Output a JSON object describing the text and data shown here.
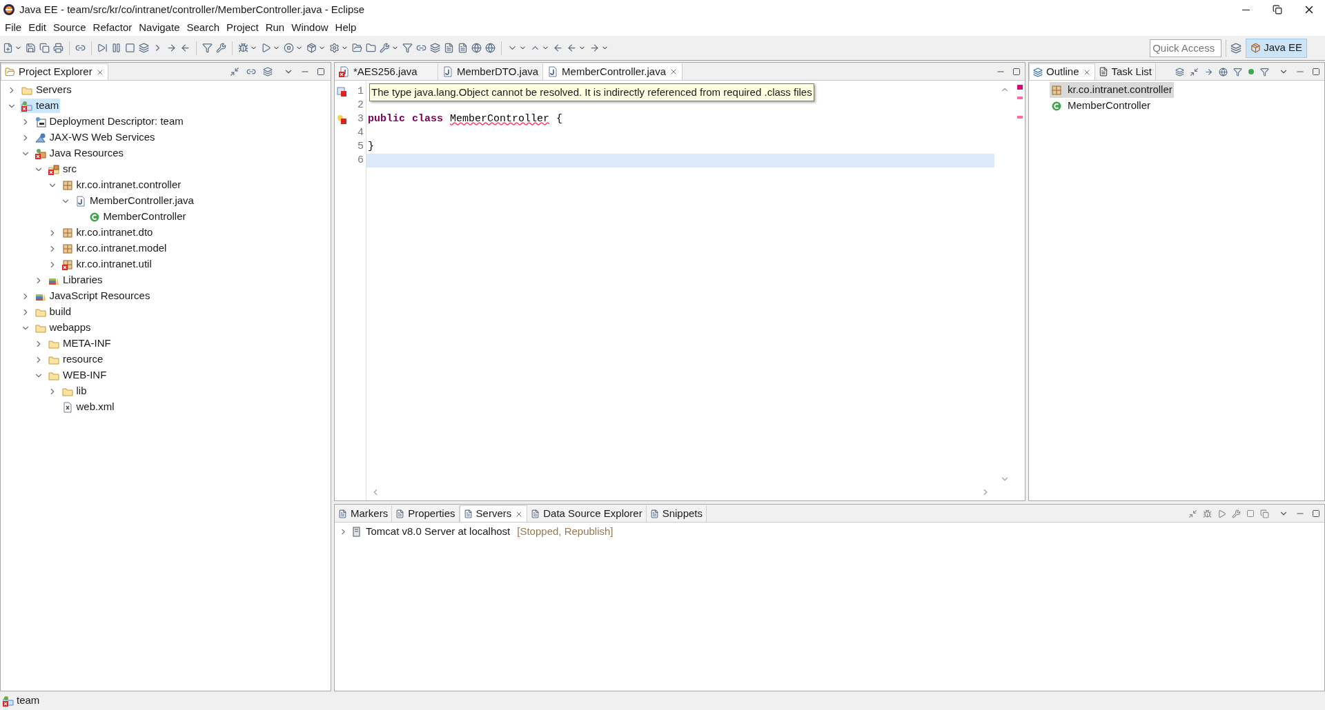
{
  "window": {
    "title": "Java EE - team/src/kr/co/intranet/controller/MemberController.java - Eclipse"
  },
  "menu": [
    "File",
    "Edit",
    "Source",
    "Refactor",
    "Navigate",
    "Search",
    "Project",
    "Run",
    "Window",
    "Help"
  ],
  "quick_access": {
    "placeholder": "Quick Access"
  },
  "perspectives": [
    {
      "label": "Java EE",
      "selected": true
    }
  ],
  "project_explorer": {
    "tabs": [
      {
        "label": "Project Explorer",
        "selected": true
      }
    ],
    "tree": [
      {
        "label": "Servers",
        "kind": "folder",
        "expanded": false,
        "selected": false,
        "error": false
      },
      {
        "label": "team",
        "kind": "project",
        "expanded": true,
        "selected": true,
        "error": true,
        "children": [
          {
            "label": "Deployment Descriptor: team",
            "kind": "descriptor",
            "expanded": false,
            "selected": false,
            "error": false
          },
          {
            "label": "JAX-WS Web Services",
            "kind": "webservice",
            "expanded": false,
            "selected": false,
            "error": false
          },
          {
            "label": "Java Resources",
            "kind": "resources",
            "expanded": true,
            "selected": false,
            "error": true,
            "children": [
              {
                "label": "src",
                "kind": "source",
                "expanded": true,
                "selected": false,
                "error": true,
                "children": [
                  {
                    "label": "kr.co.intranet.controller",
                    "kind": "package",
                    "expanded": true,
                    "selected": false,
                    "error": false,
                    "children": [
                      {
                        "label": "MemberController.java",
                        "kind": "java-file",
                        "expanded": true,
                        "selected": false,
                        "error": false,
                        "children": [
                          {
                            "label": "MemberController",
                            "kind": "class",
                            "selected": false,
                            "error": false
                          }
                        ]
                      }
                    ]
                  },
                  {
                    "label": "kr.co.intranet.dto",
                    "kind": "package",
                    "expanded": false,
                    "selected": false,
                    "error": false
                  },
                  {
                    "label": "kr.co.intranet.model",
                    "kind": "package",
                    "expanded": false,
                    "selected": false,
                    "error": false
                  },
                  {
                    "label": "kr.co.intranet.util",
                    "kind": "package",
                    "expanded": false,
                    "selected": false,
                    "error": true
                  }
                ]
              },
              {
                "label": "Libraries",
                "kind": "library",
                "expanded": false,
                "selected": false,
                "error": false
              }
            ]
          },
          {
            "label": "JavaScript Resources",
            "kind": "library",
            "expanded": false,
            "selected": false,
            "error": false
          },
          {
            "label": "build",
            "kind": "folder",
            "expanded": false,
            "selected": false,
            "error": false
          },
          {
            "label": "webapps",
            "kind": "folder",
            "expanded": true,
            "selected": false,
            "error": false,
            "children": [
              {
                "label": "META-INF",
                "kind": "folder",
                "expanded": false,
                "selected": false,
                "error": false
              },
              {
                "label": "resource",
                "kind": "folder",
                "expanded": false,
                "selected": false,
                "error": false
              },
              {
                "label": "WEB-INF",
                "kind": "folder",
                "expanded": true,
                "selected": false,
                "error": false,
                "children": [
                  {
                    "label": "lib",
                    "kind": "folder",
                    "expanded": false,
                    "selected": false,
                    "error": false
                  },
                  {
                    "label": "web.xml",
                    "kind": "xml",
                    "selected": false,
                    "error": false
                  }
                ]
              }
            ]
          }
        ]
      }
    ]
  },
  "editor": {
    "tabs": [
      {
        "label": "*AES256.java",
        "selected": false,
        "error": true
      },
      {
        "label": "MemberDTO.java",
        "selected": false,
        "error": false
      },
      {
        "label": "MemberController.java",
        "selected": true,
        "error": false
      }
    ],
    "tooltip": "The type java.lang.Object cannot be resolved. It is indirectly referenced from required .class files",
    "lines": [
      {
        "number": "1",
        "error": true,
        "quickfix": false,
        "current": false
      },
      {
        "number": "2",
        "error": false,
        "quickfix": false,
        "current": false
      },
      {
        "number": "3",
        "error": true,
        "quickfix": true,
        "current": false,
        "tokens": [
          {
            "text": "public",
            "kind": "keyword"
          },
          {
            "text": "class",
            "kind": "keyword"
          },
          {
            "text": "MemberController",
            "kind": "error"
          },
          {
            "text": "{",
            "kind": "plain"
          }
        ]
      },
      {
        "number": "4",
        "error": false,
        "quickfix": false,
        "current": false
      },
      {
        "number": "5",
        "error": false,
        "quickfix": false,
        "current": false,
        "tokens": [
          {
            "text": "}",
            "kind": "plain"
          }
        ]
      },
      {
        "number": "6",
        "error": false,
        "quickfix": false,
        "current": true
      }
    ]
  },
  "outline": {
    "tabs": [
      {
        "label": "Outline",
        "selected": true
      },
      {
        "label": "Task List",
        "selected": false
      }
    ],
    "items": [
      {
        "label": "kr.co.intranet.controller",
        "kind": "package",
        "selected": true
      },
      {
        "label": "MemberController",
        "kind": "class",
        "selected": false
      }
    ]
  },
  "bottom_panel": {
    "tabs": [
      {
        "label": "Markers",
        "selected": false
      },
      {
        "label": "Properties",
        "selected": false
      },
      {
        "label": "Servers",
        "selected": true
      },
      {
        "label": "Data Source Explorer",
        "selected": false
      },
      {
        "label": "Snippets",
        "selected": false
      }
    ],
    "servers": [
      {
        "name": "Tomcat v8.0 Server at localhost",
        "status": "[Stopped, Republish]",
        "expanded": false
      }
    ]
  },
  "status_bar": {
    "text": "team"
  }
}
